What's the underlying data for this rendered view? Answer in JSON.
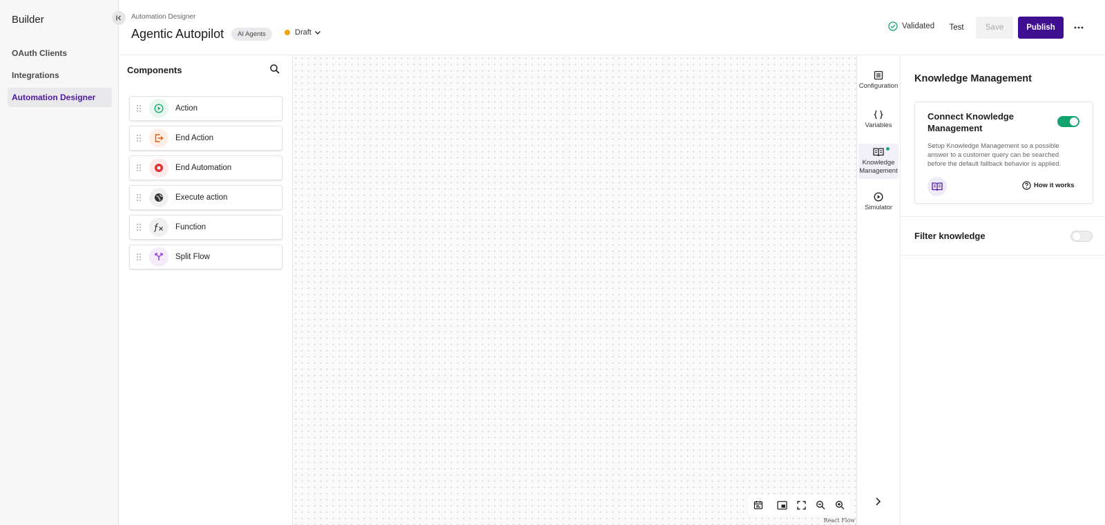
{
  "sidebar": {
    "title": "Builder",
    "items": [
      {
        "label": "OAuth Clients",
        "active": false
      },
      {
        "label": "Integrations",
        "active": false
      },
      {
        "label": "Automation Designer",
        "active": true
      }
    ]
  },
  "header": {
    "breadcrumb": "Automation Designer",
    "title": "Agentic Autopilot",
    "tag": "AI Agents",
    "status": "Draft",
    "validated": "Validated",
    "test_label": "Test",
    "save_label": "Save",
    "publish_label": "Publish"
  },
  "components": {
    "title": "Components",
    "items": [
      {
        "label": "Action",
        "icon": "play-circle-icon",
        "color": "#1aaa73"
      },
      {
        "label": "End Action",
        "icon": "exit-icon",
        "color": "#e8590c"
      },
      {
        "label": "End Automation",
        "icon": "stop-circle-icon",
        "color": "#e03131"
      },
      {
        "label": "Execute action",
        "icon": "globe-icon",
        "color": "#333333"
      },
      {
        "label": "Function",
        "icon": "function-icon",
        "color": "#333333"
      },
      {
        "label": "Split Flow",
        "icon": "split-icon",
        "color": "#9b3fd6"
      }
    ]
  },
  "canvas": {
    "attribution": "React Flow"
  },
  "rail": {
    "items": [
      {
        "label": "Configuration",
        "icon": "list-icon"
      },
      {
        "label": "Variables",
        "icon": "braces-icon"
      },
      {
        "label": "Knowledge Management",
        "icon": "book-icon",
        "active": true
      },
      {
        "label": "Simulator",
        "icon": "play-circle-icon"
      }
    ]
  },
  "panel": {
    "title": "Knowledge Management",
    "card": {
      "title": "Connect Knowledge Management",
      "toggle_on": true,
      "description": "Setup Knowledge Management so a possible answer to a customer query can be searched before the default fallback behavior is applied.",
      "link": "How it works"
    },
    "filter": {
      "label": "Filter knowledge",
      "toggle_on": false
    }
  },
  "colors": {
    "accent": "#3e0f91",
    "success": "#13a36c",
    "draft": "#f2a60d"
  }
}
